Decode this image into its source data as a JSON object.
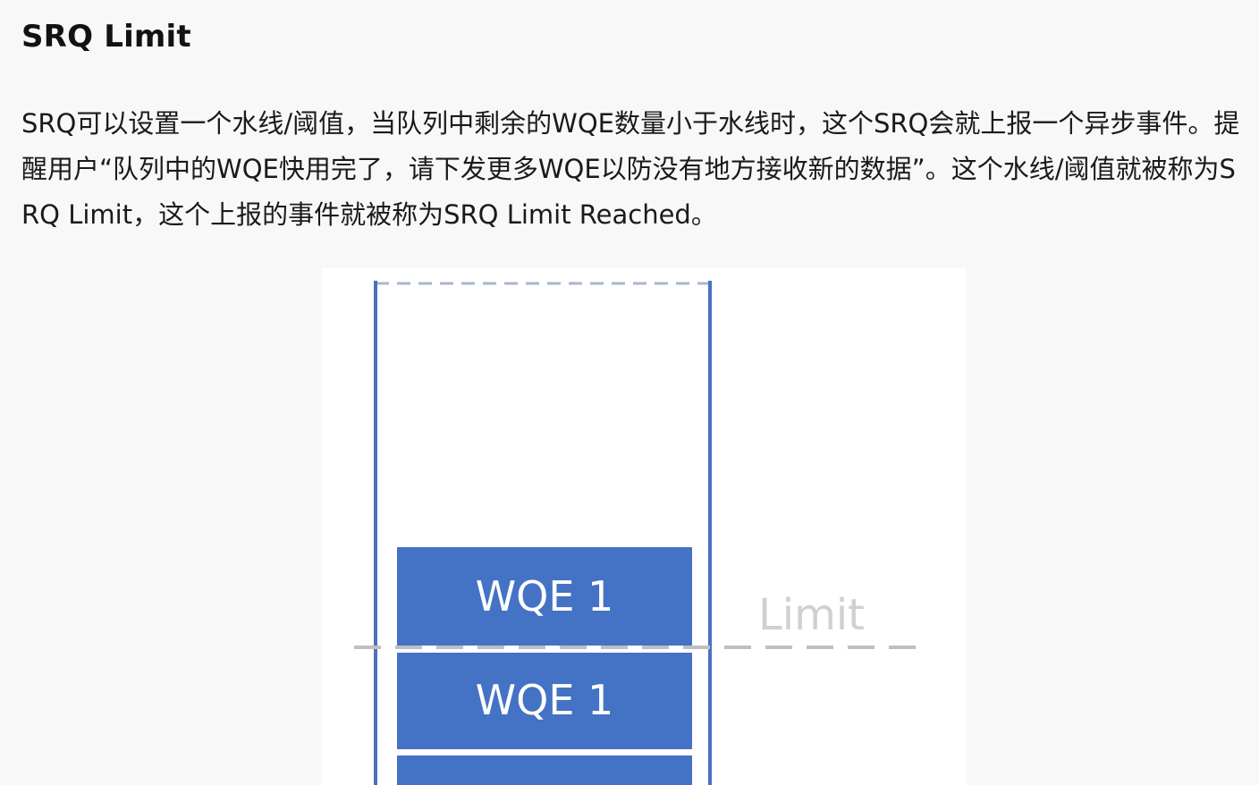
{
  "article": {
    "heading": "SRQ Limit",
    "paragraph": "SRQ可以设置一个水线/阈值，当队列中剩余的WQE数量小于水线时，这个SRQ会就上报一个异步事件。提醒用户“队列中的WQE快用完了，请下发更多WQE以防没有地方接收新的数据”。这个水线/阈值就被称为SRQ Limit，这个上报的事件就被称为SRQ Limit Reached。"
  },
  "diagram": {
    "entries": [
      "WQE 1",
      "WQE 1"
    ],
    "limit_label": "Limit",
    "colors": {
      "queue_border": "#4a72be",
      "entry_fill": "#4472c4",
      "threshold_line": "#bfbfbf",
      "limit_text": "#d0d0d0"
    }
  }
}
